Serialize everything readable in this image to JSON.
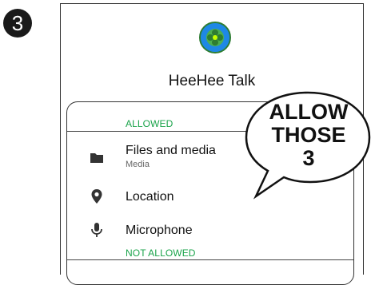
{
  "step_number": "3",
  "app": {
    "name": "HeeHee Talk",
    "icon": "app-logo-icon"
  },
  "permissions": {
    "allowed_label": "ALLOWED",
    "not_allowed_label": "NOT ALLOWED",
    "items": [
      {
        "title": "Files and media",
        "subtitle": "Media",
        "icon": "folder-icon"
      },
      {
        "title": "Location",
        "subtitle": "",
        "icon": "location-pin-icon"
      },
      {
        "title": "Microphone",
        "subtitle": "",
        "icon": "microphone-icon"
      }
    ]
  },
  "callout": {
    "lines": [
      "ALLOW",
      "THOSE",
      "3"
    ]
  },
  "colors": {
    "section_label": "#1aa34a",
    "badge": "#1a1a1a"
  }
}
